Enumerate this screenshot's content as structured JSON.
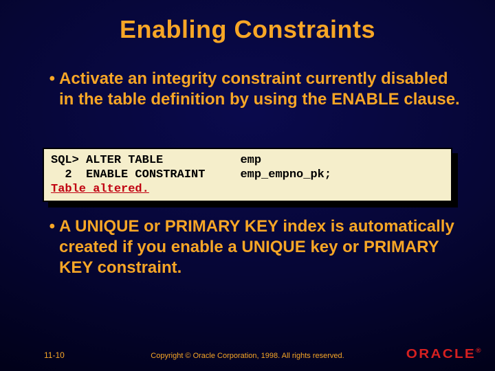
{
  "title": "Enabling Constraints",
  "bullets": [
    "Activate an integrity constraint currently disabled in the table definition by using the ENABLE clause.",
    "A UNIQUE or PRIMARY KEY index is automatically created if you enable a UNIQUE key or PRIMARY KEY constraint."
  ],
  "code": {
    "line1": "SQL> ALTER TABLE           emp",
    "line2": "  2  ENABLE CONSTRAINT     emp_empno_pk;",
    "result": "Table altered."
  },
  "footer": {
    "slide_number": "11-10",
    "copyright": "Copyright © Oracle Corporation, 1998. All rights reserved.",
    "logo_text": "ORACLE",
    "logo_reg": "®"
  }
}
